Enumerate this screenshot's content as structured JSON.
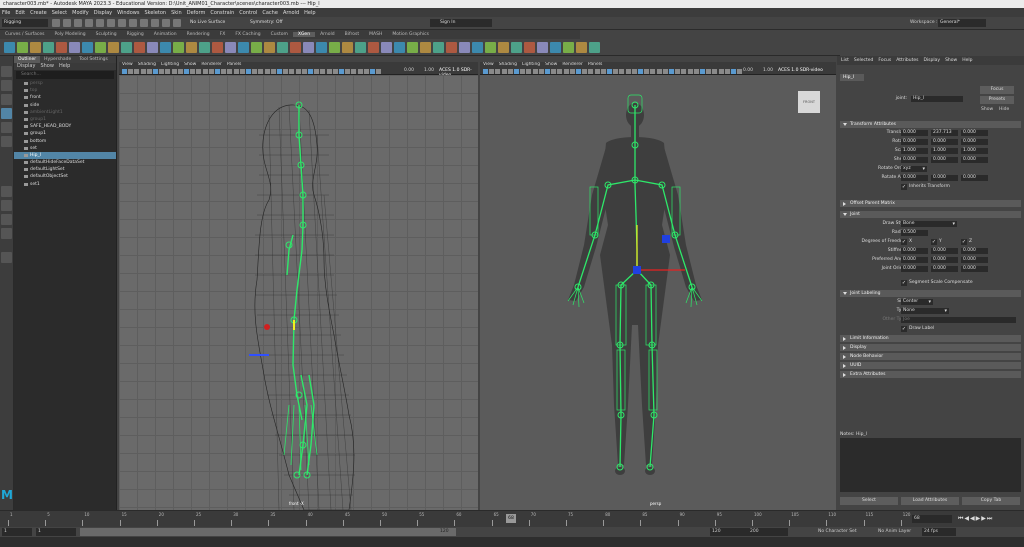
{
  "title": "character003.mb* - Autodesk MAYA 2023.3 - Educational Version: D:\\Unit_ANIM01_Character\\scenes\\character003.mb --- Hip_l",
  "menubar": [
    "File",
    "Edit",
    "Create",
    "Select",
    "Modify",
    "Display",
    "Windows",
    "Skeleton",
    "Skin",
    "Deform",
    "Constrain",
    "Control",
    "Cache",
    "Arnold",
    "Help"
  ],
  "status": {
    "workspace": "Rigging",
    "live_surface": "No Live Surface",
    "symmetry": "Symmetry: Off",
    "sign_in": "Sign In",
    "workspace_label": "Workspace :",
    "workspace_value": "General*"
  },
  "shelf_tabs": [
    {
      "label": "Curves / Surfaces",
      "on": false
    },
    {
      "label": "Poly Modeling",
      "on": false
    },
    {
      "label": "Sculpting",
      "on": false
    },
    {
      "label": "Rigging",
      "on": false
    },
    {
      "label": "Animation",
      "on": false
    },
    {
      "label": "Rendering",
      "on": false
    },
    {
      "label": "FX",
      "on": false
    },
    {
      "label": "FX Caching",
      "on": false
    },
    {
      "label": "Custom",
      "on": false
    },
    {
      "label": "XGen",
      "on": true
    },
    {
      "label": "Arnold",
      "on": false
    },
    {
      "label": "Bifrost",
      "on": false
    },
    {
      "label": "MASH",
      "on": false
    },
    {
      "label": "Motion Graphics",
      "on": false
    }
  ],
  "outliner": {
    "tabs": [
      "Outliner",
      "Hypershade",
      "Tool Settings"
    ],
    "menu": [
      "Display",
      "Show",
      "Help"
    ],
    "search": "Search...",
    "items": [
      {
        "label": "persp",
        "dim": true
      },
      {
        "label": "top",
        "dim": true
      },
      {
        "label": "front",
        "dim": false
      },
      {
        "label": "side",
        "dim": false
      },
      {
        "label": "ambientLight1",
        "dim": true
      },
      {
        "label": "group1",
        "dim": true
      },
      {
        "label": "SAFE_HEAD_BODY",
        "dim": false
      },
      {
        "label": "group1",
        "dim": false
      },
      {
        "label": "bottom",
        "dim": false
      },
      {
        "label": "set",
        "dim": false
      },
      {
        "label": "Hip_l",
        "sel": true
      },
      {
        "label": "defaultHideFaceDataSet",
        "dim": false
      },
      {
        "label": "defaultLightSet",
        "dim": false
      },
      {
        "label": "defaultObjectSet",
        "dim": false
      },
      {
        "label": "set1",
        "dim": false
      }
    ]
  },
  "viewport": {
    "menu": [
      "View",
      "Shading",
      "Lighting",
      "Show",
      "Renderer",
      "Panels"
    ],
    "left_label": "front -X",
    "right_label": "persp",
    "cube_label": "FRONT",
    "exposure": "0.00",
    "gamma": "1.00",
    "color_space": "ACES 1.0 SDR-video"
  },
  "attr": {
    "menu": [
      "List",
      "Selected",
      "Focus",
      "Attributes",
      "Display",
      "Show",
      "Help"
    ],
    "tab": "Hip_l",
    "joint_label": "joint:",
    "joint_value": "Hip_l",
    "focus": "Focus",
    "presets": "Presets",
    "show": "Show",
    "hide": "Hide",
    "sections": {
      "transform": "Transform Attributes",
      "offset": "Offset Parent Matrix",
      "joint": "Joint",
      "labeling": "Joint Labeling",
      "limit": "Limit Information",
      "display": "Display",
      "node": "Node Behavior",
      "uuid": "UUID",
      "extra": "Extra Attributes"
    },
    "translate": {
      "label": "Translate",
      "v": [
        "0.000",
        "237.713",
        "0.000"
      ]
    },
    "rotate": {
      "label": "Rotate",
      "v": [
        "0.000",
        "0.000",
        "0.000"
      ]
    },
    "scale": {
      "label": "Scale",
      "v": [
        "1.000",
        "1.000",
        "1.000"
      ]
    },
    "shear": {
      "label": "Shear",
      "v": [
        "0.000",
        "0.000",
        "0.000"
      ]
    },
    "rotate_order_label": "Rotate Order",
    "rotate_order": "xyz",
    "rotate_axis": {
      "label": "Rotate Axis",
      "v": [
        "0.000",
        "0.000",
        "0.000"
      ]
    },
    "inherits": "Inherits Transform",
    "draw_style_label": "Draw Style",
    "draw_style": "Bone",
    "radius_label": "Radius",
    "radius": "0.500",
    "dof_label": "Degrees of Freedom",
    "dof": [
      "X",
      "Y",
      "Z"
    ],
    "stiffness": {
      "label": "Stiffness",
      "v": [
        "0.000",
        "0.000",
        "0.000"
      ]
    },
    "pref_angle": {
      "label": "Preferred Angle",
      "v": [
        "0.000",
        "0.000",
        "0.000"
      ]
    },
    "joint_orient": {
      "label": "Joint Orient",
      "v": [
        "0.000",
        "0.000",
        "0.000"
      ]
    },
    "segment": "Segment Scale Compensate",
    "side_label": "Side",
    "side": "Center",
    "type_label": "Type",
    "type": "None",
    "other_label": "Other Type",
    "other": "Joe",
    "draw_label": "Draw Label",
    "notes": "Notes: Hip_l",
    "buttons": [
      "Select",
      "Load Attributes",
      "Copy Tab"
    ]
  },
  "timeline": {
    "ticks": [
      "1",
      "5",
      "10",
      "15",
      "20",
      "25",
      "30",
      "35",
      "40",
      "45",
      "50",
      "55",
      "60",
      "65",
      "70",
      "75",
      "80",
      "85",
      "90",
      "95",
      "100",
      "105",
      "110",
      "115",
      "120"
    ],
    "current": "68",
    "frame": "68"
  },
  "range": {
    "start": "1",
    "start2": "1",
    "end": "120",
    "end2": "120",
    "max": "200",
    "mid": "120",
    "no_char": "No Character Set",
    "no_anim": "No Anim Layer",
    "fps": "24 fps"
  },
  "colors": {
    "joint": "#2ee86a",
    "selected": "#5285a6"
  }
}
